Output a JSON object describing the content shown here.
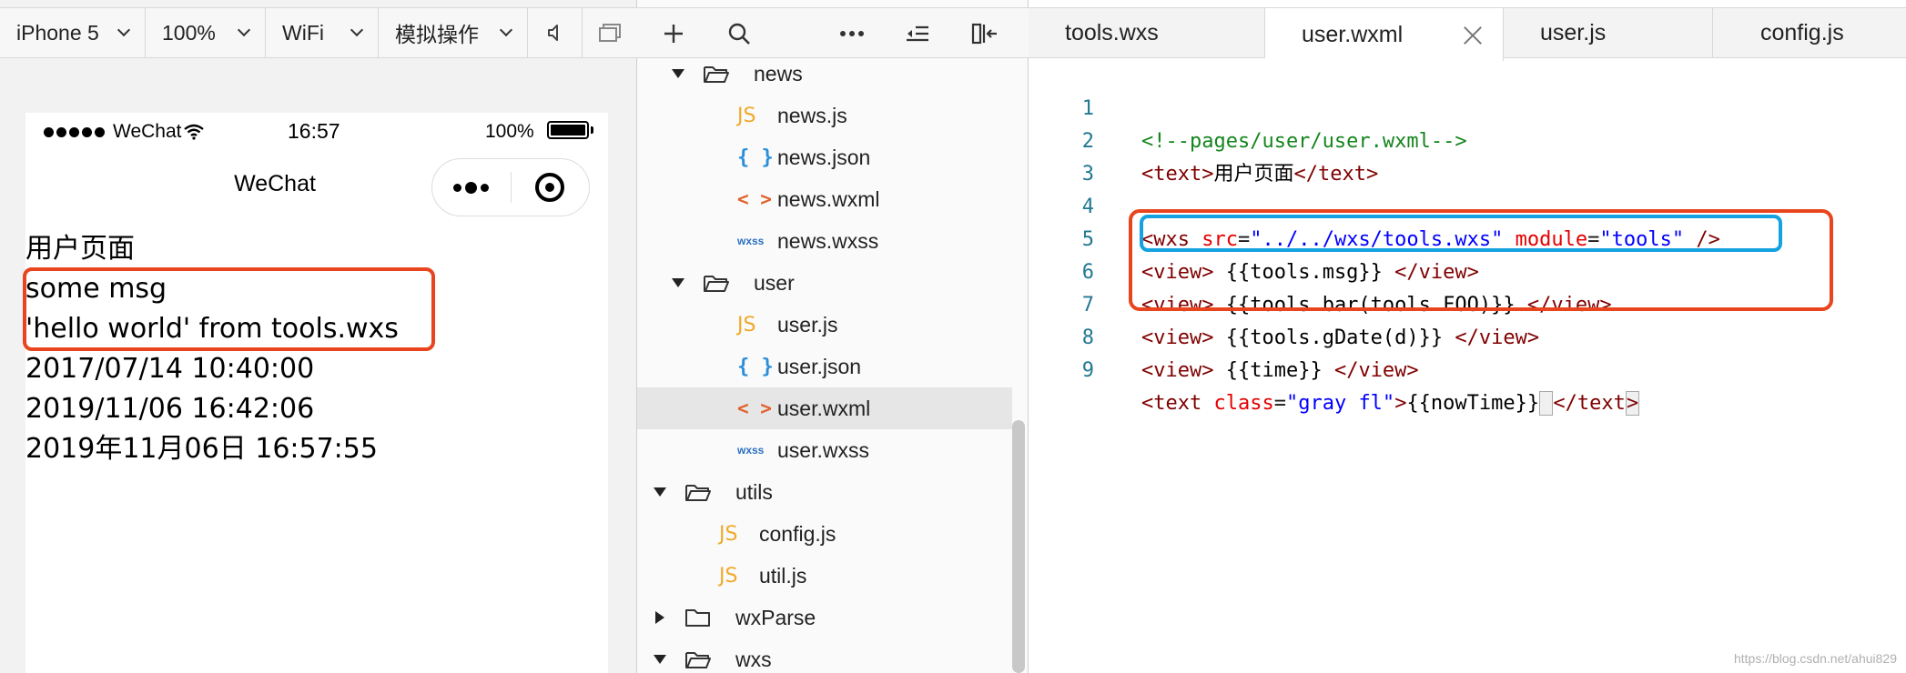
{
  "simulator": {
    "toolbar": {
      "device": "iPhone 5",
      "zoom": "100%",
      "network": "WiFi",
      "operation": "模拟操作"
    },
    "status_bar": {
      "carrier": "WeChat",
      "time": "16:57",
      "battery": "100%",
      "battery_level": 1.0
    },
    "nav_title": "WeChat",
    "page_lines": [
      "用户页面",
      "some msg",
      "'hello world' from tools.wxs",
      "2017/07/14 10:40:00",
      "2019/11/06 16:42:06",
      "2019年11月06日 16:57:55"
    ]
  },
  "explorer": {
    "tree": [
      {
        "label": "news",
        "kind": "folder",
        "expanded": true
      },
      {
        "label": "news.js",
        "kind": "js",
        "icon": "JS"
      },
      {
        "label": "news.json",
        "kind": "json",
        "icon": "{ }"
      },
      {
        "label": "news.wxml",
        "kind": "wxml",
        "icon": "< >"
      },
      {
        "label": "news.wxss",
        "kind": "wxss",
        "icon": "wxss"
      },
      {
        "label": "user",
        "kind": "folder",
        "expanded": true
      },
      {
        "label": "user.js",
        "kind": "js",
        "icon": "JS"
      },
      {
        "label": "user.json",
        "kind": "json",
        "icon": "{ }"
      },
      {
        "label": "user.wxml",
        "kind": "wxml",
        "icon": "< >",
        "selected": true
      },
      {
        "label": "user.wxss",
        "kind": "wxss",
        "icon": "wxss"
      },
      {
        "label": "utils",
        "kind": "folder",
        "expanded": true
      },
      {
        "label": "config.js",
        "kind": "js",
        "icon": "JS"
      },
      {
        "label": "util.js",
        "kind": "js",
        "icon": "JS"
      },
      {
        "label": "wxParse",
        "kind": "folder",
        "expanded": false
      },
      {
        "label": "wxs",
        "kind": "folder",
        "expanded": true
      }
    ]
  },
  "editor": {
    "tabs": [
      {
        "label": "tools.wxs"
      },
      {
        "label": "user.wxml",
        "active": true
      },
      {
        "label": "user.js"
      },
      {
        "label": "config.js"
      }
    ],
    "line_numbers": [
      "1",
      "2",
      "3",
      "4",
      "5",
      "6",
      "7",
      "8",
      "9"
    ],
    "code": {
      "l1": "<!--pages/user/user.wxml-->",
      "l2_open": "<text>",
      "l2_text": "用户页面",
      "l2_close": "</text>",
      "l4_wxs": "<wxs",
      "l4_src_attr": "src",
      "l4_src_val": "\"../../wxs/tools.wxs\"",
      "l4_module_attr": "module",
      "l4_module_val": "\"tools\"",
      "l4_end": "/>",
      "l5_open": "<view>",
      "l5_text": "{{tools.msg}}",
      "l5_close": "</view>",
      "l6_open": "<view>",
      "l6_text": "{{tools.bar(tools.FOO)}}",
      "l6_close": "</view>",
      "l7_open": "<view>",
      "l7_text": "{{tools.gDate(d)}}",
      "l7_close": "</view>",
      "l8_open": "<view>",
      "l8_text": "{{time}}",
      "l8_close": "</view>",
      "l9_open": "<text",
      "l9_attr": "class",
      "l9_val": "\"gray fl\"",
      "l9_gt": ">",
      "l9_text": "{{nowTime}}",
      "l9_close": "</text",
      "l9_close_gt": ">"
    }
  },
  "watermark": "https://blog.csdn.net/ahui829",
  "colors": {
    "highlight_red": "#e8451e",
    "highlight_blue": "#14a3e0"
  }
}
